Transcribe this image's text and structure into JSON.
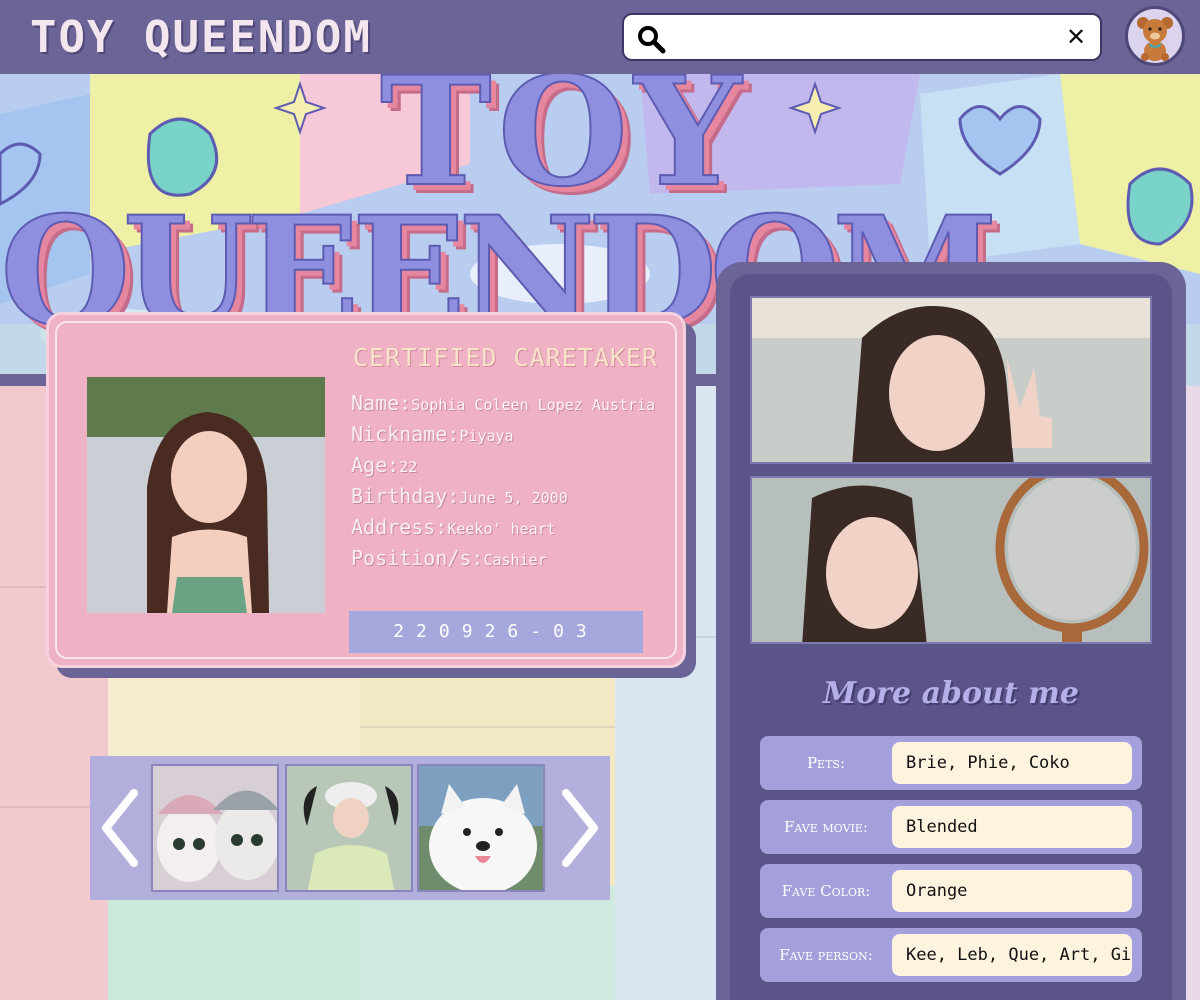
{
  "header": {
    "brand": "TOY QUEENDOM",
    "search": {
      "value": "",
      "placeholder": ""
    },
    "icons": {
      "search": "search-icon",
      "clear": "close-icon",
      "avatar": "teddy-bear-avatar"
    }
  },
  "banner": {
    "letters_top": "TOY",
    "letters_bottom": "QUEENDOM"
  },
  "card": {
    "title": "CERTIFIED CARETAKER",
    "fields": [
      {
        "label": "Name:",
        "value": "Sophia Coleen Lopez Austria"
      },
      {
        "label": "Nickname:",
        "value": "Piyaya"
      },
      {
        "label": "Age:",
        "value": "22"
      },
      {
        "label": "Birthday:",
        "value": "June 5, 2000"
      },
      {
        "label": "Address:",
        "value": "Keeko' heart"
      },
      {
        "label": "Position/s:",
        "value": "Cashier"
      }
    ],
    "id_number": "220926-03"
  },
  "carousel": {
    "prev_icon": "chevron-left-icon",
    "next_icon": "chevron-right-icon",
    "thumbs": [
      "cats-photo",
      "person-photo",
      "samoyed-dog-photo"
    ]
  },
  "more": {
    "title": "More about me",
    "rows": [
      {
        "label": "Pets:",
        "value": "Brie, Phie, Coko"
      },
      {
        "label": "Fave movie:",
        "value": "Blended"
      },
      {
        "label": "Fave Color:",
        "value": "Orange"
      },
      {
        "label": "Fave person:",
        "value": "Kee, Leb, Que, Art, Gia"
      }
    ]
  },
  "colors": {
    "topbar": "#6b6597",
    "card": "#efb1c4",
    "panel": "#5a5488",
    "row": "#a3a0db",
    "value_bg": "#fdf3de"
  }
}
